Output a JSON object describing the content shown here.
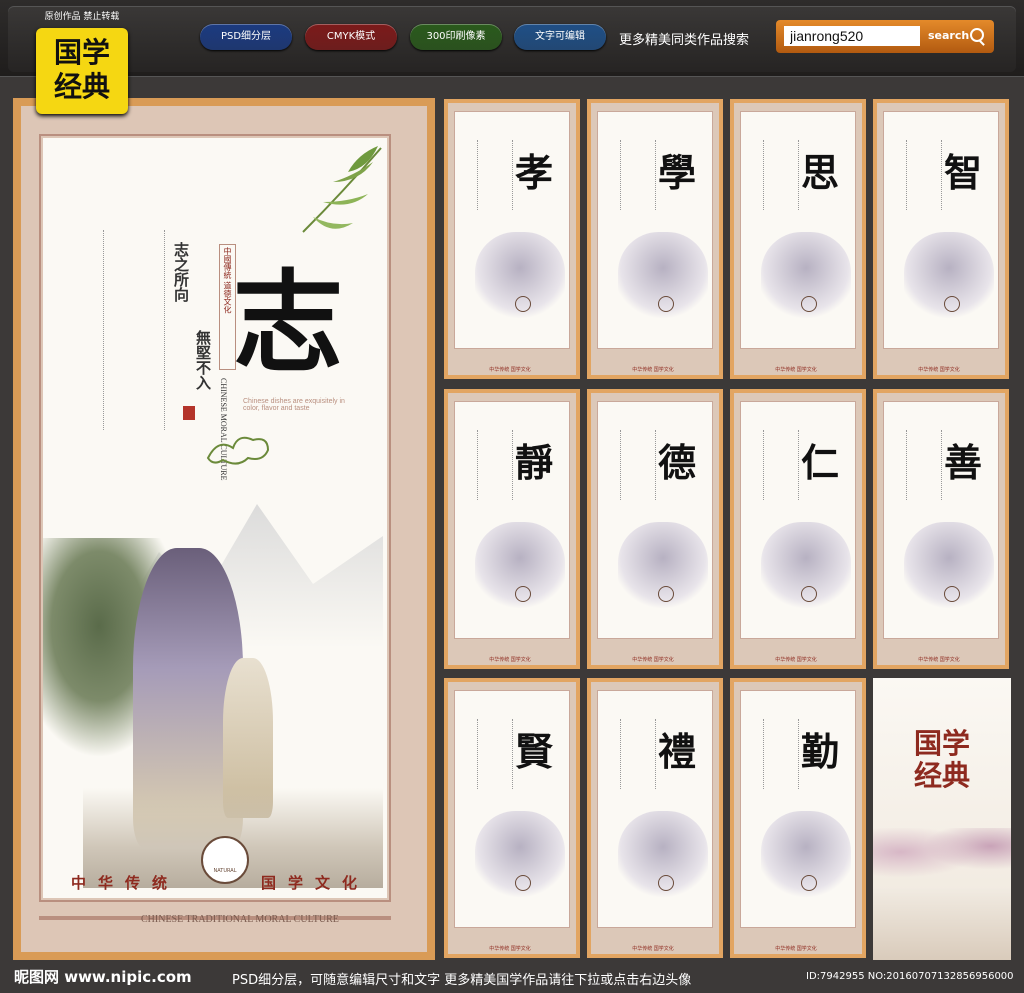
{
  "header": {
    "logo_caption": "原创作品 禁止转载",
    "logo_text": "国学经典",
    "pills": [
      {
        "label": "PSD细分层",
        "color": "#1b3a80"
      },
      {
        "label": "CMYK模式",
        "color": "#7c1a1a"
      },
      {
        "label": "300印刷像素",
        "color": "#2a5a1c"
      },
      {
        "label": "文字可编辑",
        "color": "#1f4f86"
      }
    ],
    "search_label": "更多精美同类作品搜索",
    "search_value": "jianrong520",
    "search_button": "search"
  },
  "main_poster": {
    "character": "志",
    "vertical_title_1": "志之所向",
    "vertical_title_2": "無堅不入",
    "vertical_small": "中國傳統 道德文化",
    "english_vertical": "CHINESE MORAL CULTURE",
    "english_blurb": "Chinese dishes are exquisitely in color, flavor and taste",
    "slogan_left": "中华传统",
    "slogan_right": "国学文化",
    "emblem_text": "NATURAL",
    "english_footer": "CHINESE TRADITIONAL MORAL CULTURE"
  },
  "thumbnails": [
    {
      "char": "孝"
    },
    {
      "char": "學"
    },
    {
      "char": "思"
    },
    {
      "char": "智"
    },
    {
      "char": "靜"
    },
    {
      "char": "德"
    },
    {
      "char": "仁"
    },
    {
      "char": "善"
    },
    {
      "char": "賢"
    },
    {
      "char": "禮"
    },
    {
      "char": "勤"
    }
  ],
  "thumbnail_footer": "中华传统 国学文化",
  "cover": {
    "title": "国学经典"
  },
  "footer": {
    "site": "昵图网 www.nipic.com",
    "note": "PSD细分层，可随意编辑尺寸和文字 更多精美国学作品请往下拉或点击右边头像",
    "id": "ID:7942955 NO:20160707132856956000"
  }
}
